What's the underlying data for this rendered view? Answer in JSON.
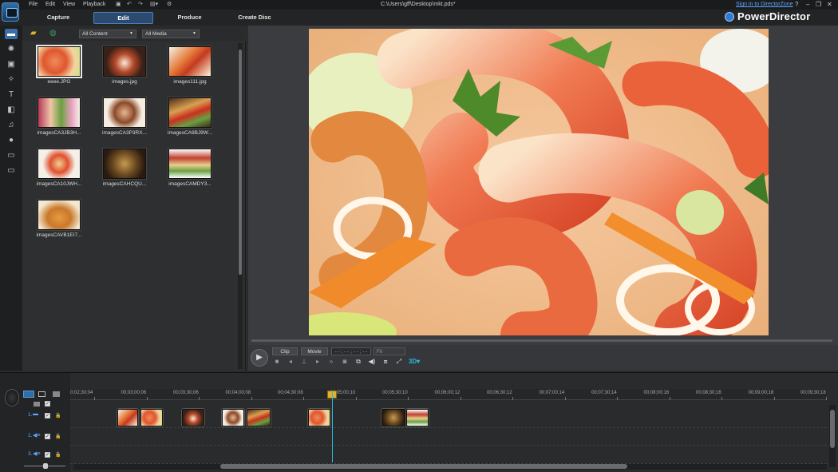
{
  "menu": [
    "File",
    "Edit",
    "View",
    "Playback"
  ],
  "file_path": "C:\\Users\\gff\\Desktop\\mkt.pds*",
  "sign_in": "Sign in to DirectorZone",
  "window_controls": [
    "?",
    "–",
    "❐",
    "✕"
  ],
  "tabs": [
    {
      "label": "Capture",
      "active": false
    },
    {
      "label": "Edit",
      "active": true
    },
    {
      "label": "Produce",
      "active": false
    },
    {
      "label": "Create Disc",
      "active": false
    }
  ],
  "brand": "PowerDirector",
  "library": {
    "content_filter": "All Content",
    "media_filter": "All Media",
    "items": [
      {
        "caption": "eeee.JPG",
        "img": "f1",
        "selected": true
      },
      {
        "caption": "images.jpg",
        "img": "f2"
      },
      {
        "caption": "images111.jpg",
        "img": "f3"
      },
      {
        "caption": "imagesCA3JB3H...",
        "img": "f4"
      },
      {
        "caption": "imagesCA3P3RX...",
        "img": "f5"
      },
      {
        "caption": "imagesCA9BJ9W...",
        "img": "f6"
      },
      {
        "caption": "imagesCA10JWH...",
        "img": "f7"
      },
      {
        "caption": "imagesCAHCQU...",
        "img": "f8"
      },
      {
        "caption": "imagesCAMDY3...",
        "img": "f9"
      },
      {
        "caption": "imagesCAVB1EI7...",
        "img": "f10"
      }
    ]
  },
  "preview": {
    "mode_clip": "Clip",
    "mode_movie": "Movie",
    "timecode": "- - ; - - ; - - ; - -",
    "fit": "Fit",
    "threed": "3D"
  },
  "timeline": {
    "ruler": [
      "0;02;30;04",
      "00;03;00;06",
      "00;03;30;06",
      "00;04;00;08",
      "00;04;30;08",
      "00;05;00;10",
      "00;05;30;10",
      "00;06;00;12",
      "00;06;30;12",
      "00;07;00;14",
      "00;07;30;14",
      "00;08;00;16",
      "00;08;30;16",
      "00;09;00;18",
      "00;09;30;18"
    ],
    "tracks": [
      {
        "label": "1."
      },
      {
        "label": "1."
      },
      {
        "label": "3."
      }
    ],
    "clips": [
      "f3",
      "f1",
      "f2",
      "f5",
      "f6",
      "f1",
      "f8",
      "f9"
    ]
  }
}
